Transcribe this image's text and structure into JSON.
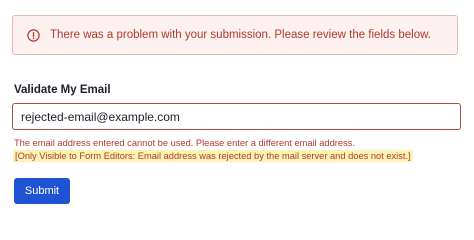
{
  "alert": {
    "icon": "exclamation-circle-icon",
    "message": "There was a problem with your submission. Please review the fields below."
  },
  "field": {
    "label": "Validate My Email",
    "value": "rejected-email@example.com",
    "error": "The email address entered cannot be used. Please enter a different email address.",
    "editor_note": "[Only Visible to Form Editors: Email address was rejected by the mail server and does not exist.]"
  },
  "submit": {
    "label": "Submit"
  },
  "colors": {
    "error": "#b03a30",
    "alert_background": "#fcf1f0",
    "highlight": "#fbf3b4",
    "button": "#1e53d4"
  }
}
